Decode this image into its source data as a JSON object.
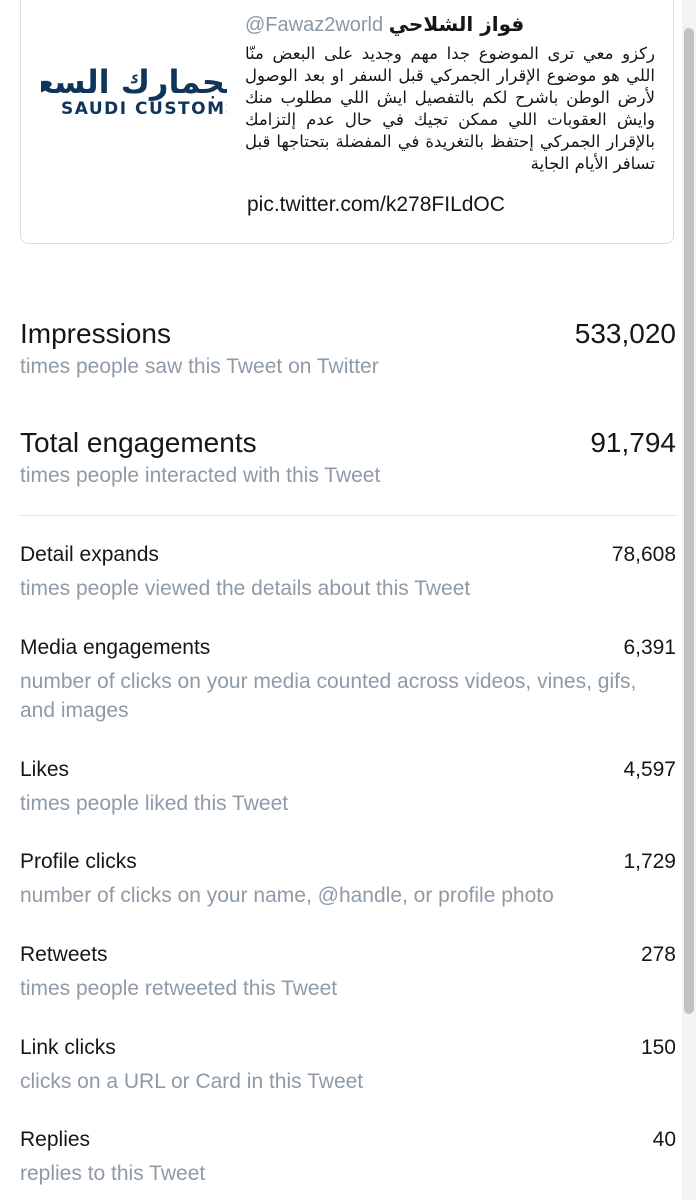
{
  "tweet": {
    "logo_ar": "لجمارك السعودية",
    "logo_en": "SAUDI CUSTOMS",
    "name": "فواز الشلاحي",
    "handle": "@Fawaz2world",
    "text": "ركزو معي ترى الموضوع جدا مهم وجديد على البعض منّا اللي هو موضوع الإقرار الجمركي قبل السفر او بعد الوصول لأرض الوطن باشرح لكم بالتفصيل ايش اللي مطلوب منك وايش العقوبات اللي ممكن تجيك في حال عدم إلتزامك بالإقرار الجمركي إحتفظ بالتغريدة في المفضلة بتحتاجها قبل تسافر الأيام الجاية",
    "link": "pic.twitter.com/k278FILdOC"
  },
  "metrics": [
    {
      "label": "Impressions",
      "value": "533,020",
      "description": "times people saw this Tweet on Twitter"
    },
    {
      "label": "Total engagements",
      "value": "91,794",
      "description": "times people interacted with this Tweet"
    },
    {
      "label": "Detail expands",
      "value": "78,608",
      "description": "times people viewed the details about this Tweet"
    },
    {
      "label": "Media engagements",
      "value": "6,391",
      "description": "number of clicks on your media counted across videos, vines, gifs, and images"
    },
    {
      "label": "Likes",
      "value": "4,597",
      "description": "times people liked this Tweet"
    },
    {
      "label": "Profile clicks",
      "value": "1,729",
      "description": "number of clicks on your name, @handle, or profile photo"
    },
    {
      "label": "Retweets",
      "value": "278",
      "description": "times people retweeted this Tweet"
    },
    {
      "label": "Link clicks",
      "value": "150",
      "description": "clicks on a URL or Card in this Tweet"
    },
    {
      "label": "Replies",
      "value": "40",
      "description": "replies to this Tweet"
    }
  ],
  "colors": {
    "text": "#14171a",
    "secondary_text": "#8e9ba7",
    "logo": "#11355a",
    "border": "#d7dde2"
  }
}
